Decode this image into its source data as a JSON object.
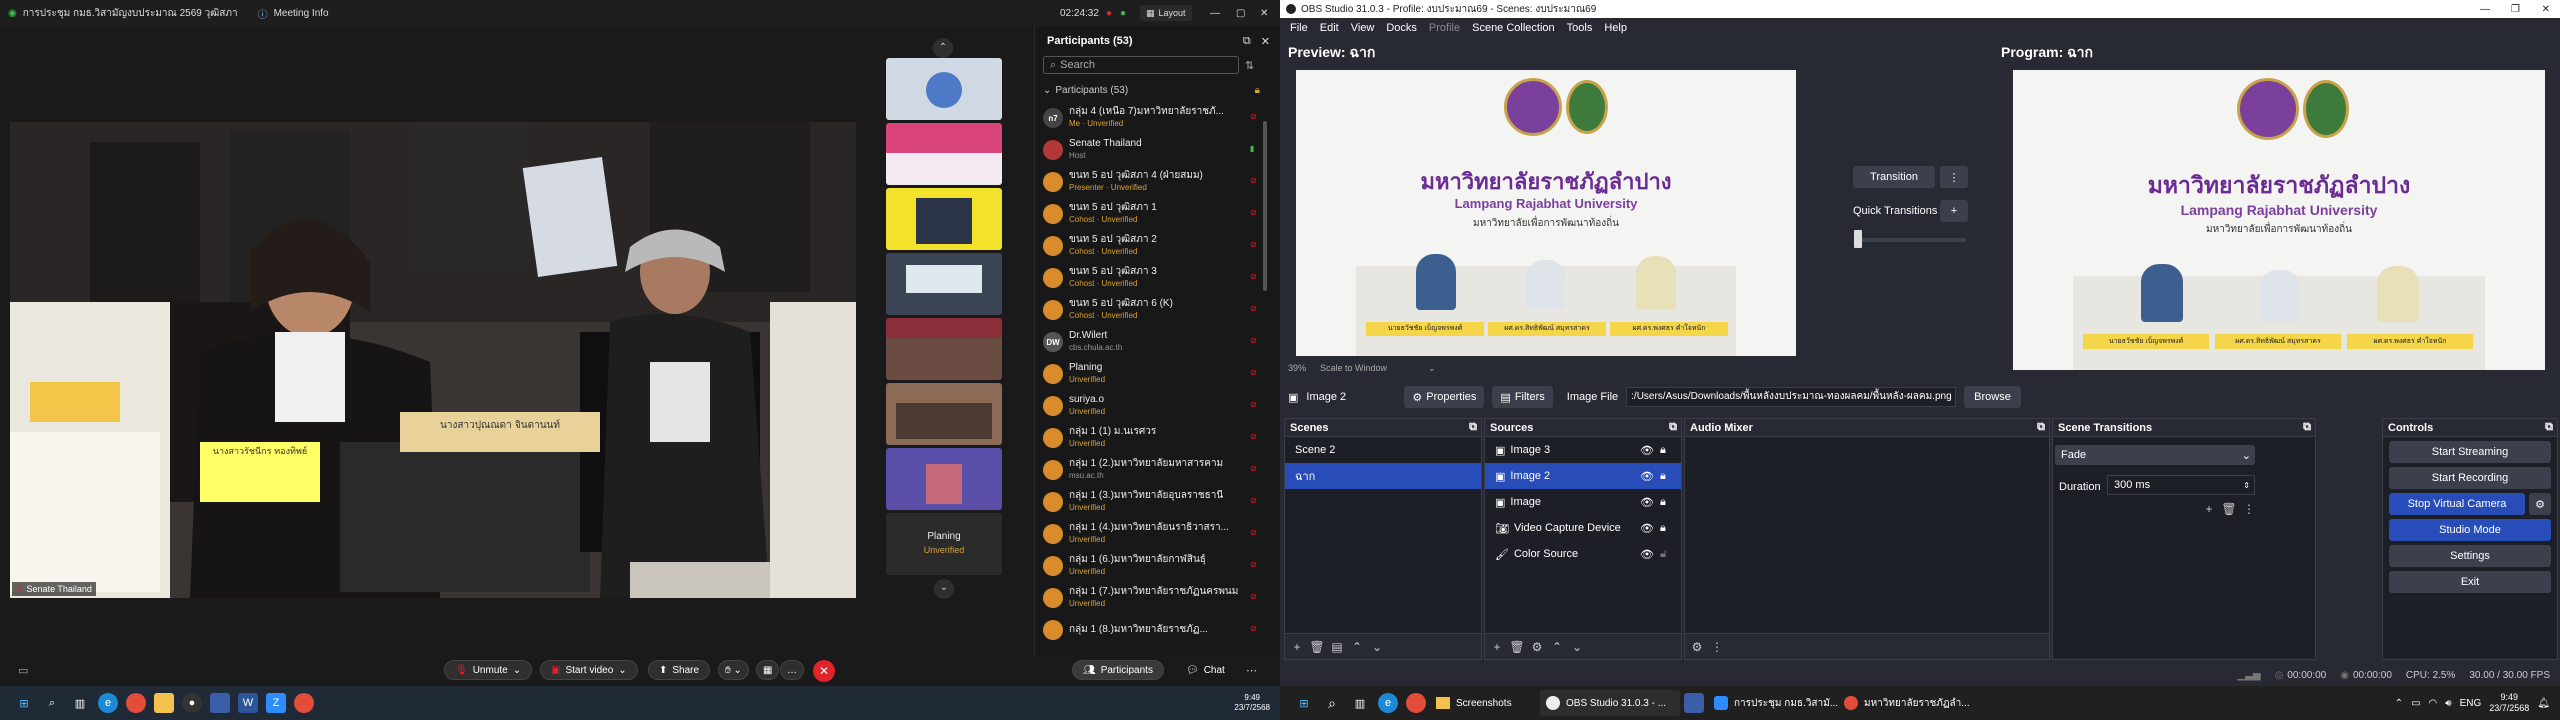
{
  "zoom": {
    "title_left": "การประชุม กมธ.วิสามัญงบประมาณ 2569 วุฒิสภา",
    "meeting_info": "Meeting Info",
    "timer": "02:24:32",
    "layout_label": "Layout",
    "speaker_label": "Senate Thailand",
    "nameplate_left": "นางสาวรัชนีกร ทองทิพย์",
    "nameplate_right": "นางสาวปุณณดา จินดานนท์",
    "controls": {
      "unmute": "Unmute",
      "start_video": "Start video",
      "share": "Share",
      "participants": "Participants",
      "chat": "Chat"
    },
    "thumb_last_name": "Planing",
    "thumb_last_status": "Unverified",
    "panel": {
      "title": "Participants (53)",
      "search_placeholder": "Search",
      "section": "Participants (53)",
      "rows": [
        {
          "name": "กลุ่ม 4 (เหนือ 7)มหาวิทยาลัยราชภั...",
          "status": "Me · Unverified",
          "avatar": "n7"
        },
        {
          "name": "Senate Thailand",
          "status": "Host",
          "avatar": ""
        },
        {
          "name": "ขนท 5 อป วุฒิสภา 4 (ฝ่ายสมม)",
          "status": "Presenter · Unverified",
          "avatar": ""
        },
        {
          "name": "ขนท 5 อป วุฒิสภา 1",
          "status": "Cohost · Unverified",
          "avatar": ""
        },
        {
          "name": "ขนท 5 อป วุฒิสภา 2",
          "status": "Cohost · Unverified",
          "avatar": ""
        },
        {
          "name": "ขนท 5 อป วุฒิสภา 3",
          "status": "Cohost · Unverified",
          "avatar": ""
        },
        {
          "name": "ขนท 5 อป วุฒิสภา 6 (K)",
          "status": "Cohost · Unverified",
          "avatar": ""
        },
        {
          "name": "Dr.Wilert",
          "status": "cbs.chula.ac.th",
          "avatar": "DW"
        },
        {
          "name": "Planing",
          "status": "Unverified",
          "avatar": ""
        },
        {
          "name": "suriya.o",
          "status": "Unverified",
          "avatar": ""
        },
        {
          "name": "กลุ่ม 1 (1) ม.นเรศวร",
          "status": "Unverified",
          "avatar": ""
        },
        {
          "name": "กลุ่ม 1 (2.)มหาวิทยาลัยมหาสารคาม",
          "status": "msu.ac.th",
          "avatar": ""
        },
        {
          "name": "กลุ่ม 1 (3.)มหาวิทยาลัยอุบลราชธานี",
          "status": "Unverified",
          "avatar": ""
        },
        {
          "name": "กลุ่ม 1 (4.)มหาวิทยาลัยนราธิวาสรา...",
          "status": "Unverified",
          "avatar": ""
        },
        {
          "name": "กลุ่ม 1 (6.)มหาวิทยาลัยกาฬสินธุ์",
          "status": "Unverified",
          "avatar": ""
        },
        {
          "name": "กลุ่ม 1 (7.)มหาวิทยาลัยราชภัฏนครพนม",
          "status": "Unverified",
          "avatar": ""
        },
        {
          "name": "กลุ่ม 1 (8.)มหาวิทยาลัยราชภัฏ...",
          "status": "",
          "avatar": ""
        }
      ]
    }
  },
  "taskbar_left": {
    "time": "9:49",
    "date": "23/7/2568"
  },
  "obs": {
    "title": "OBS Studio 31.0.3 - Profile: งบประมาณ69 - Scenes: งบประมาณ69",
    "menu": [
      "File",
      "Edit",
      "View",
      "Docks",
      "Profile",
      "Scene Collection",
      "Tools",
      "Help"
    ],
    "preview_label": "Preview: ฉาก",
    "program_label": "Program: ฉาก",
    "transition_btn": "Transition",
    "quick_transitions": "Quick Transitions",
    "zoom_pct": "39%",
    "scale_mode": "Scale to Window",
    "slide": {
      "thai_name": "มหาวิทยาลัยราชภัฏลำปาง",
      "eng_name": "Lampang Rajabhat University",
      "tagline": "มหาวิทยาลัยเพื่อการพัฒนาท้องถิ่น",
      "plate1": "นายธวัชชัย เบ็ญจพรพงศ์",
      "plate2": "ผศ.ดร.สิทธิพัฒน์ สมุทรสาคร",
      "plate3": "ผศ.ดร.พงศธร คำใจหนัก"
    },
    "props": {
      "source_name": "Image 2",
      "properties": "Properties",
      "filters": "Filters",
      "image_file_label": "Image File",
      "image_file_value": ":/Users/Asus/Downloads/พื้นหลังงบประมาณ-ทองผลคม/พื้นหลัง-ผลคม.png",
      "browse": "Browse"
    },
    "scenes": {
      "title": "Scenes",
      "items": [
        "Scene 2",
        "ฉาก"
      ],
      "selected": 1
    },
    "sources": {
      "title": "Sources",
      "items": [
        "Image 3",
        "Image 2",
        "Image",
        "Video Capture Device",
        "Color Source"
      ],
      "selected": 1
    },
    "audio_mixer": {
      "title": "Audio Mixer"
    },
    "transitions": {
      "title": "Scene Transitions",
      "type": "Fade",
      "duration_label": "Duration",
      "duration_value": "300 ms"
    },
    "controls": {
      "title": "Controls",
      "start_streaming": "Start Streaming",
      "start_recording": "Start Recording",
      "stop_virtual_camera": "Stop Virtual Camera",
      "studio_mode": "Studio Mode",
      "settings": "Settings",
      "exit": "Exit"
    },
    "status": {
      "stream_time": "00:00:00",
      "rec_time": "00:00:00",
      "cpu": "CPU: 2.5%",
      "fps": "30.00 / 30.00 FPS"
    }
  },
  "taskbar_right": {
    "apps": [
      "Screenshots",
      "OBS Studio 31.0.3 - ...",
      "การประชุม กมธ.วิสามั...",
      "มหาวิทยาลัยราชภัฏลำ..."
    ],
    "lang": "ENG",
    "time": "9:49",
    "date": "23/7/2568"
  },
  "colors": {
    "accent_blue": "#284cb8",
    "zoom_orange": "#d98c2b",
    "unverified": "#d6a23a",
    "leave_red": "#e0242a"
  }
}
